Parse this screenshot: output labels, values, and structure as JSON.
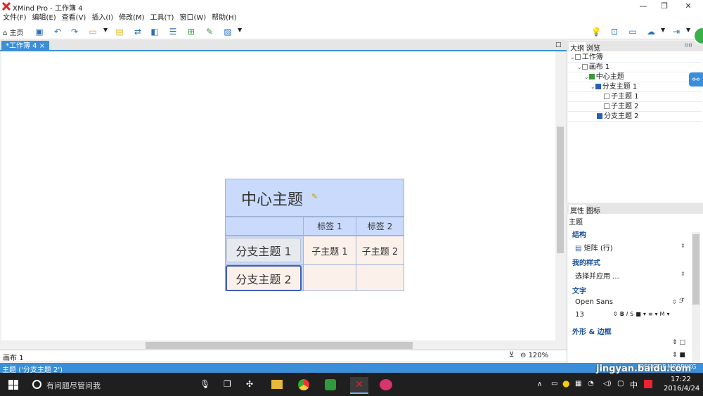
{
  "window": {
    "title": "XMind Pro - 工作簿 4"
  },
  "menu": [
    "文件(F)",
    "编辑(E)",
    "查看(V)",
    "插入(I)",
    "修改(M)",
    "工具(T)",
    "窗口(W)",
    "帮助(H)"
  ],
  "toolbar": {
    "home_label": "主页"
  },
  "tab": {
    "label": "*工作簿 4"
  },
  "map": {
    "central": "中心主题",
    "labels": [
      "标签 1",
      "标签 2"
    ],
    "branch1": "分支主题 1",
    "branch2": "分支主题 2",
    "sub1": "子主题 1",
    "sub2": "子主题 2"
  },
  "outline": {
    "tabs": [
      "大纲",
      "浏览"
    ],
    "rows": [
      "工作簿",
      "画布 1",
      "中心主题",
      "分支主题 1",
      "子主题 1",
      "子主题 2",
      "分支主题 2"
    ]
  },
  "properties": {
    "tabs": [
      "属性",
      "图标"
    ],
    "subject": "主题",
    "structure_title": "结构",
    "structure_value": "矩阵 (行)",
    "style_title": "我的样式",
    "style_value": "选择并应用 ...",
    "text_title": "文字",
    "font": "Open Sans",
    "size": "13",
    "shape_title": "外形 & 边框"
  },
  "sheetbar": {
    "sheet": "画布 1",
    "zoom": "120%"
  },
  "status": {
    "text": "主题 ('分支主题 2')",
    "right": "DESKTOP-MDBPNKG"
  },
  "taskbar": {
    "search": "有问题尽管问我",
    "time": "17:22",
    "date": "2016/4/24",
    "ime": "中"
  },
  "watermark": {
    "text": "jingyan.baidu.com"
  },
  "colors": {
    "accent": "#3b8fd8",
    "central_fill": "#c9dafc",
    "cell_fill": "#fcf1ea",
    "selected_border": "#3e5eb3"
  }
}
